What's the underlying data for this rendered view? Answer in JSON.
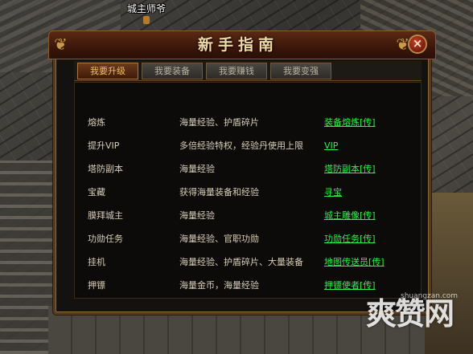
{
  "world": {
    "npc_name": "城主师爷"
  },
  "panel": {
    "title": "新手指南",
    "close_label": "×",
    "tabs": [
      {
        "label": "我要升级",
        "active": true
      },
      {
        "label": "我要装备",
        "active": false
      },
      {
        "label": "我要赚钱",
        "active": false
      },
      {
        "label": "我要变强",
        "active": false
      }
    ],
    "rows": [
      {
        "name": "熔炼",
        "desc": "海量经验、护盾碎片",
        "link": "装备熔炼[传]"
      },
      {
        "name": "提升VIP",
        "desc": "多倍经验特权，经验丹使用上限",
        "link": "VIP"
      },
      {
        "name": "塔防副本",
        "desc": "海量经验",
        "link": "塔防副本[传]"
      },
      {
        "name": "宝藏",
        "desc": "获得海量装备和经验",
        "link": "寻宝"
      },
      {
        "name": "膜拜城主",
        "desc": "海量经验",
        "link": "城主雕像[传]"
      },
      {
        "name": "功勋任务",
        "desc": "海量经验、官职功勋",
        "link": "功勋任务[传]"
      },
      {
        "name": "挂机",
        "desc": "海量经验、护盾碎片、大量装备",
        "link": "地图传送员[传]"
      },
      {
        "name": "押镖",
        "desc": "海量金币，海量经验",
        "link": "押镖使者[传]"
      }
    ]
  },
  "watermark": {
    "text": "爽赞网",
    "url": "shuangzan.com"
  },
  "colors": {
    "link": "#2ef04a",
    "text": "#d8cdb8",
    "title": "#f0d9a8",
    "active_tab": "#f0c060"
  }
}
